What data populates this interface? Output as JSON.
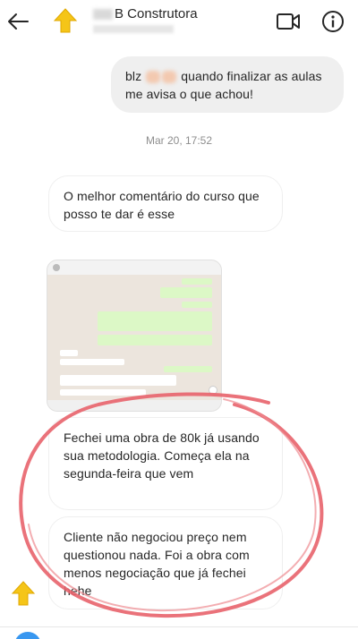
{
  "header": {
    "title": "B Construtora",
    "back_icon": "arrow-left-icon",
    "video_icon": "video-camera-icon",
    "info_icon": "info-icon",
    "avatar_color": "#f5c518"
  },
  "messages": {
    "outgoing_1_before": "blz",
    "outgoing_1_after": "quando finalizar as aulas me avisa o que achou!",
    "timestamp": "Mar 20, 17:52",
    "incoming_1": "O melhor comentário do curso que posso te dar é esse",
    "incoming_2": "Fechei uma obra de 80k já usando sua metodologia. Começa ela na segunda-feira que vem",
    "incoming_3": "Cliente não negociou preço nem questionou nada. Foi a obra com menos negociação que já fechei hehe"
  },
  "colors": {
    "outgoing_bubble": "#efefef",
    "annotation_circle": "#e8636b"
  }
}
